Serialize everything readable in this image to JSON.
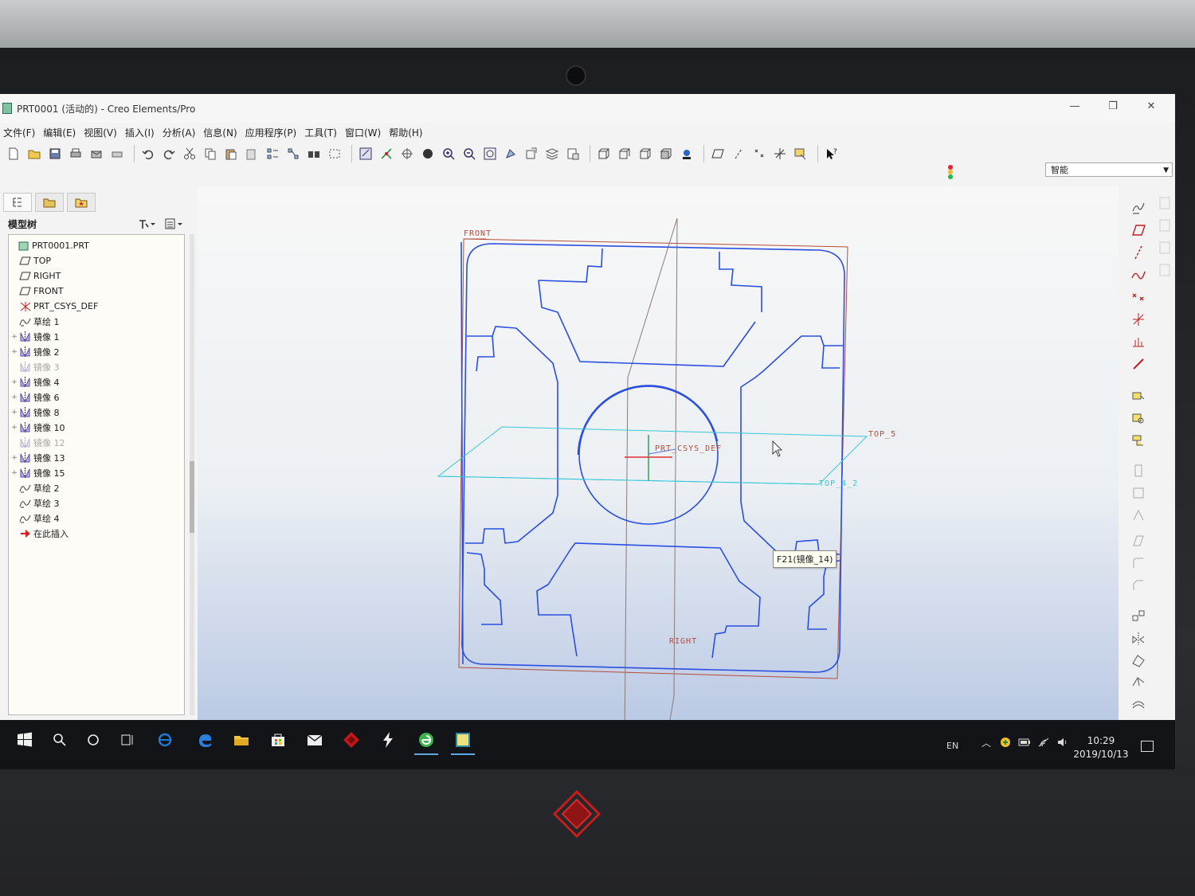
{
  "window": {
    "title": "PRT0001 (活动的) - Creo Elements/Pro",
    "controls": [
      "—",
      "❐",
      "✕"
    ]
  },
  "menu": [
    "文件(F)",
    "编辑(E)",
    "视图(V)",
    "插入(I)",
    "分析(A)",
    "信息(N)",
    "应用程序(P)",
    "工具(T)",
    "窗口(W)",
    "帮助(H)"
  ],
  "toolbar": {
    "filter_value": "智能",
    "icons": [
      "new-icon",
      "open-icon",
      "save-icon",
      "print-icon",
      "send-icon",
      "print2-icon",
      "undo-icon",
      "redo-icon",
      "cut-icon",
      "copy-icon",
      "paste-icon",
      "paste-special-icon",
      "regenerate-icon",
      "regen-manager-icon",
      "find-icon",
      "select-box-icon",
      "repaint-icon",
      "orient-icon",
      "spin-center-icon",
      "shade-icon",
      "zoom-in-icon",
      "zoom-out-icon",
      "refit-icon",
      "reorient-icon",
      "saved-views-icon",
      "layers-icon",
      "view-manager-icon",
      "wireframe-icon",
      "hidden-line-icon",
      "no-hidden-icon",
      "shading-icon",
      "enhanced-realism-icon",
      "datum-plane-toggle-icon",
      "datum-axis-toggle-icon",
      "datum-point-toggle-icon",
      "csys-toggle-icon",
      "annotation-toggle-icon",
      "context-help-icon"
    ]
  },
  "model_tree": {
    "header": "模型树",
    "items": [
      {
        "label": "PRT0001.PRT",
        "icon": "part-icon",
        "expand": "",
        "dim": false,
        "indent": 0
      },
      {
        "label": "TOP",
        "icon": "datum-plane-icon",
        "expand": "",
        "dim": false,
        "indent": 1
      },
      {
        "label": "RIGHT",
        "icon": "datum-plane-icon",
        "expand": "",
        "dim": false,
        "indent": 1
      },
      {
        "label": "FRONT",
        "icon": "datum-plane-icon",
        "expand": "",
        "dim": false,
        "indent": 1
      },
      {
        "label": "PRT_CSYS_DEF",
        "icon": "csys-icon",
        "expand": "",
        "dim": false,
        "indent": 1
      },
      {
        "label": "草绘 1",
        "icon": "sketch-icon",
        "expand": "",
        "dim": false,
        "indent": 1
      },
      {
        "label": "镜像 1",
        "icon": "mirror-icon",
        "expand": "+",
        "dim": false,
        "indent": 1
      },
      {
        "label": "镜像 2",
        "icon": "mirror-icon",
        "expand": "+",
        "dim": false,
        "indent": 1
      },
      {
        "label": "镜像 3",
        "icon": "mirror-icon",
        "expand": "",
        "dim": true,
        "indent": 1
      },
      {
        "label": "镜像 4",
        "icon": "mirror-icon",
        "expand": "+",
        "dim": false,
        "indent": 1
      },
      {
        "label": "镜像 6",
        "icon": "mirror-icon",
        "expand": "+",
        "dim": false,
        "indent": 1
      },
      {
        "label": "镜像 8",
        "icon": "mirror-icon",
        "expand": "+",
        "dim": false,
        "indent": 1
      },
      {
        "label": "镜像 10",
        "icon": "mirror-icon",
        "expand": "+",
        "dim": false,
        "indent": 1
      },
      {
        "label": "镜像 12",
        "icon": "mirror-icon",
        "expand": "",
        "dim": true,
        "indent": 1
      },
      {
        "label": "镜像 13",
        "icon": "mirror-icon",
        "expand": "+",
        "dim": false,
        "indent": 1
      },
      {
        "label": "镜像 15",
        "icon": "mirror-icon",
        "expand": "+",
        "dim": false,
        "indent": 1
      },
      {
        "label": "草绘 2",
        "icon": "sketch-icon",
        "expand": "",
        "dim": false,
        "indent": 1
      },
      {
        "label": "草绘 3",
        "icon": "sketch-icon",
        "expand": "",
        "dim": false,
        "indent": 1
      },
      {
        "label": "草绘 4",
        "icon": "sketch-icon",
        "expand": "",
        "dim": false,
        "indent": 1
      },
      {
        "label": "在此插入",
        "icon": "insert-here-icon",
        "expand": "",
        "dim": false,
        "indent": 1
      }
    ]
  },
  "graphics": {
    "labels": {
      "front": "FRONT",
      "right": "RIGHT",
      "csys": "PRT_CSYS_DEF",
      "top5": "TOP_5",
      "top42": "TOP_4_2"
    },
    "tooltip": "F21(镜像_14)",
    "colors": {
      "sketch": "#2b4fe0",
      "datum_plane": "#b44d3c",
      "highlight": "#38c8d6",
      "axis_green": "#1aa04a",
      "axis_red": "#e03030"
    }
  },
  "right_toolbar": {
    "icons": [
      "sketch-tool-icon",
      "datum-plane-tool-icon",
      "datum-axis-tool-icon",
      "datum-curve-tool-icon",
      "datum-point-tool-icon",
      "csys-tool-icon",
      "analysis-tool-icon",
      "ref-tool-icon",
      "extrude-icon",
      "revolve-icon",
      "sweep-icon",
      "hole-icon",
      "shell-icon",
      "rib-icon",
      "draft-icon",
      "round-icon",
      "chamfer-icon",
      "pattern-icon",
      "mirror-tool-icon",
      "merge-icon",
      "trim-icon",
      "offset-icon"
    ]
  },
  "taskbar": {
    "apps": [
      "windows-start-icon",
      "search-icon",
      "cortana-icon",
      "task-view-icon",
      "ie-icon",
      "edge-icon",
      "file-explorer-icon",
      "store-icon",
      "mail-icon",
      "game-app-icon",
      "bolt-app-icon",
      "browser-360-icon",
      "creo-app-icon"
    ],
    "lang": "EN",
    "time": "10:29",
    "date": "2019/10/13"
  }
}
